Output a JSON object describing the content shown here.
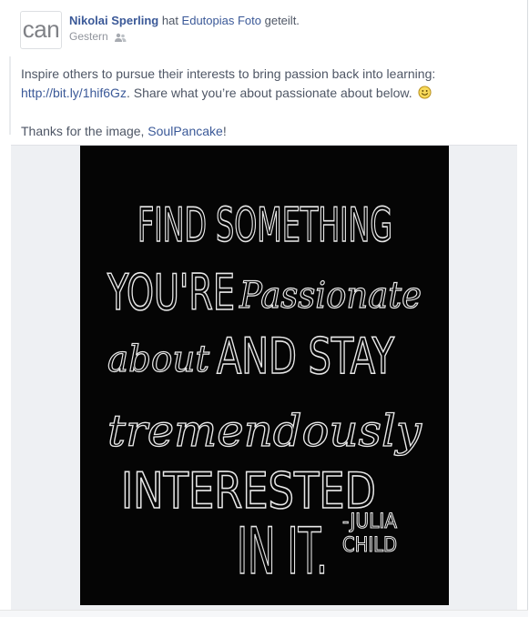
{
  "post": {
    "avatar_text": "can",
    "author": "Nikolai Sperling",
    "action_prefix": " hat ",
    "shared_object": "Edutopias Foto",
    "action_suffix": " geteilt.",
    "timestamp": "Gestern",
    "audience_icon": "friends-icon",
    "message": {
      "line1": "Inspire others to pursue their interests to bring passion back into learning:",
      "link": "http://bit.ly/1hif6Gz",
      "line2_rest": ". Share what you’re about passionate about below.",
      "emoji": "smiley-icon",
      "thanks_prefix": "Thanks for the image, ",
      "thanks_link": "SoulPancake",
      "thanks_suffix": "!"
    },
    "photo": {
      "background": "#050505",
      "ink": "#e8e8e8",
      "quote": [
        "FIND SOMETHING",
        "YOU'RE",
        "Passionate",
        "about",
        "AND STAY",
        "tremendously",
        "INTERESTED",
        "IN IT."
      ],
      "attribution": [
        "-JULIA",
        "CHILD"
      ]
    }
  },
  "colors": {
    "link": "#3b5998",
    "text": "#4e5665",
    "meta": "#90949c"
  }
}
